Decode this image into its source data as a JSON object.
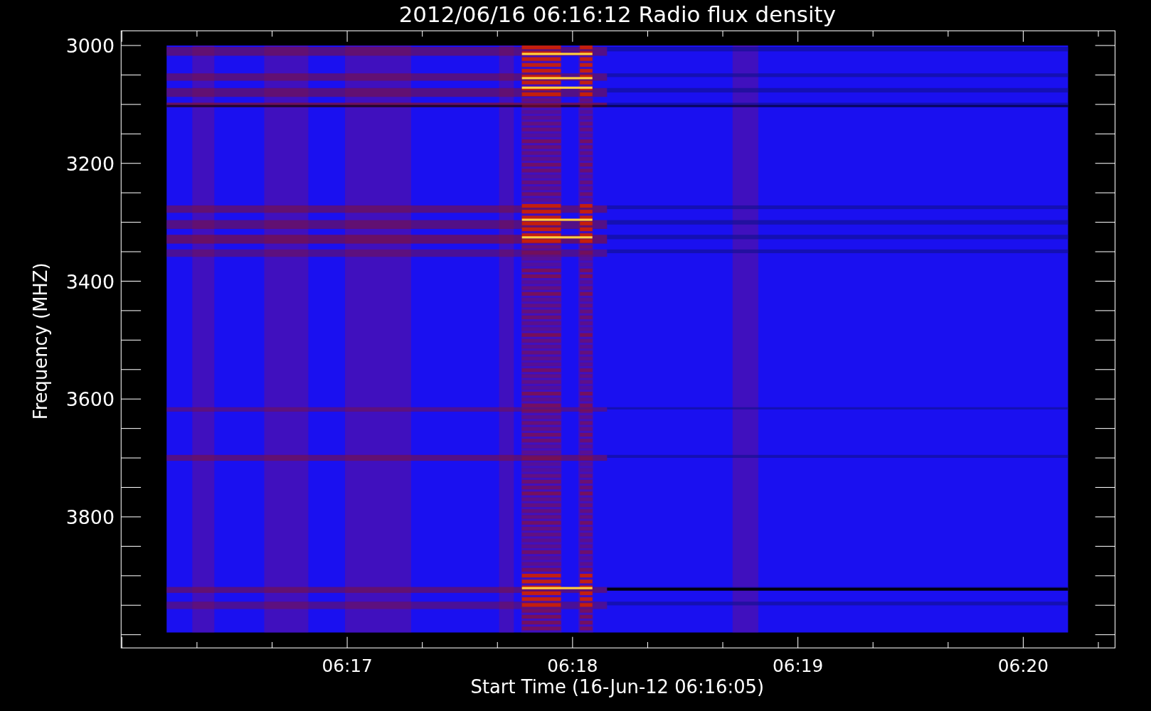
{
  "title": "2012/06/16 06:16:12 Radio flux density",
  "y_axis": {
    "label": "Frequency (MHZ)",
    "ticks": [
      "3000",
      "3200",
      "3400",
      "3600",
      "3800"
    ]
  },
  "x_axis": {
    "label": "Start Time (16-Jun-12 06:16:05)",
    "ticks": [
      "06:17",
      "06:18",
      "06:19",
      "06:20"
    ]
  }
}
